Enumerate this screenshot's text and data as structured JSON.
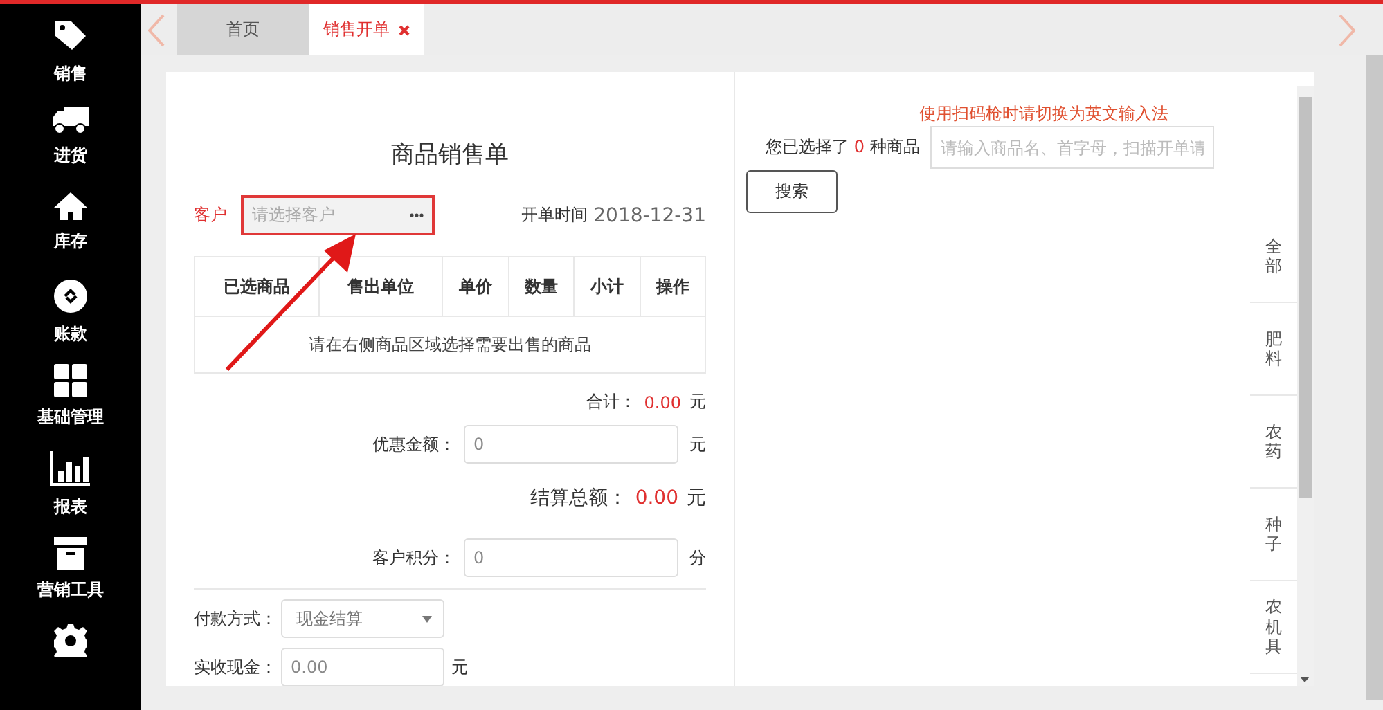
{
  "sidebar": {
    "items": [
      {
        "kind": "tag",
        "label": "销售"
      },
      {
        "kind": "truck",
        "label": "进货"
      },
      {
        "kind": "house",
        "label": "库存"
      },
      {
        "kind": "link",
        "label": "账款"
      },
      {
        "kind": "grid",
        "label": "基础管理"
      },
      {
        "kind": "chart",
        "label": "报表"
      },
      {
        "kind": "box",
        "label": "营销工具"
      },
      {
        "kind": "gear"
      }
    ]
  },
  "tabs": [
    {
      "label": "首页",
      "selected": false
    },
    {
      "label": "销售开单",
      "selected": true
    }
  ],
  "order": {
    "title": "商品销售单",
    "customer_label": "客户",
    "customer_placeholder": "请选择客户",
    "date_label": "开单时间",
    "date_value": "2018-12-31",
    "table": {
      "columns": [
        "已选商品",
        "售出单位",
        "单价",
        "数量",
        "小计",
        "操作"
      ],
      "empty_message": "请在右侧商品区域选择需要出售的商品"
    },
    "total_label": "合计：",
    "total_value": "0.00",
    "total_unit": "元",
    "discount_label": "优惠金额：",
    "discount_value": "0",
    "discount_unit": "元",
    "settle_label": "结算总额：",
    "settle_value": "0.00",
    "settle_unit": "元",
    "points_label": "客户积分：",
    "points_value": "0",
    "points_unit": "分",
    "payment_label": "付款方式：",
    "payment_value": "现金结算",
    "cash_label": "实收现金：",
    "cash_value": "0.00",
    "cash_unit": "元"
  },
  "products": {
    "hint": "使用扫码枪时请切换为英文输入法",
    "count_prefix": "您已选择了",
    "count": "0",
    "count_suffix": "种商品",
    "search_placeholder": "请输入商品名、首字母，扫描开单请",
    "search_button": "搜索",
    "categories": [
      {
        "label": "全部"
      },
      {
        "label": "肥料"
      },
      {
        "label": "农药"
      },
      {
        "label": "种子"
      },
      {
        "label": "农机具"
      }
    ]
  }
}
